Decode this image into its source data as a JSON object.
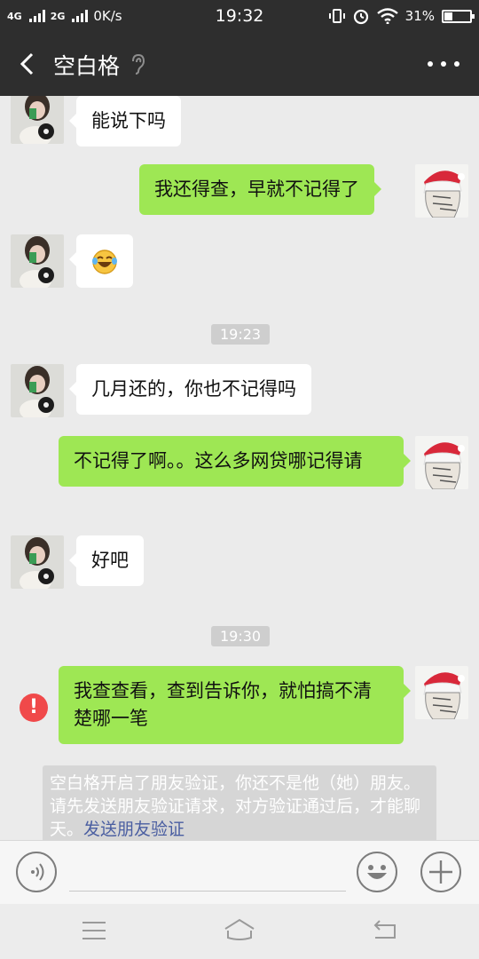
{
  "status_bar": {
    "network1": "4G",
    "network2": "2G",
    "speed": "0K/s",
    "time": "19:32",
    "battery": "31%",
    "battery_level": 0.31
  },
  "header": {
    "title": "空白格",
    "icons": [
      "back-icon",
      "ear-icon",
      "more-icon"
    ]
  },
  "messages": [
    {
      "side": "in",
      "text": "能说下吗"
    },
    {
      "side": "out",
      "text": "我还得查，早就不记得了"
    },
    {
      "side": "in",
      "text": "",
      "emoji": "laughing-crying-emoji"
    },
    {
      "type": "time",
      "text": "19:23"
    },
    {
      "side": "in",
      "text": "几月还的，你也不记得吗"
    },
    {
      "side": "out",
      "text": "不记得了啊。。这么多网贷哪记得请"
    },
    {
      "side": "in",
      "text": "好吧"
    },
    {
      "type": "time",
      "text": "19:30"
    },
    {
      "side": "out",
      "text": "我查查看，查到告诉你，就怕搞不清楚哪一笔",
      "failed": true
    }
  ],
  "notice": {
    "text": "空白格开启了朋友验证，你还不是他（她）朋友。请先发送朋友验证请求，对方验证通过后，才能聊天。",
    "link": "发送朋友验证"
  },
  "input_bar": {
    "icons": [
      "voice-icon",
      "emoji-icon",
      "plus-icon"
    ]
  },
  "nav_bar": {
    "icons": [
      "menu-icon",
      "home-icon",
      "back-nav-icon"
    ]
  },
  "colors": {
    "header_bg": "#2e2e2e",
    "chat_bg": "#ebebeb",
    "out_bubble": "#9ee754",
    "in_bubble": "#ffffff",
    "error": "#f0494a",
    "link": "#4a5ea1"
  }
}
